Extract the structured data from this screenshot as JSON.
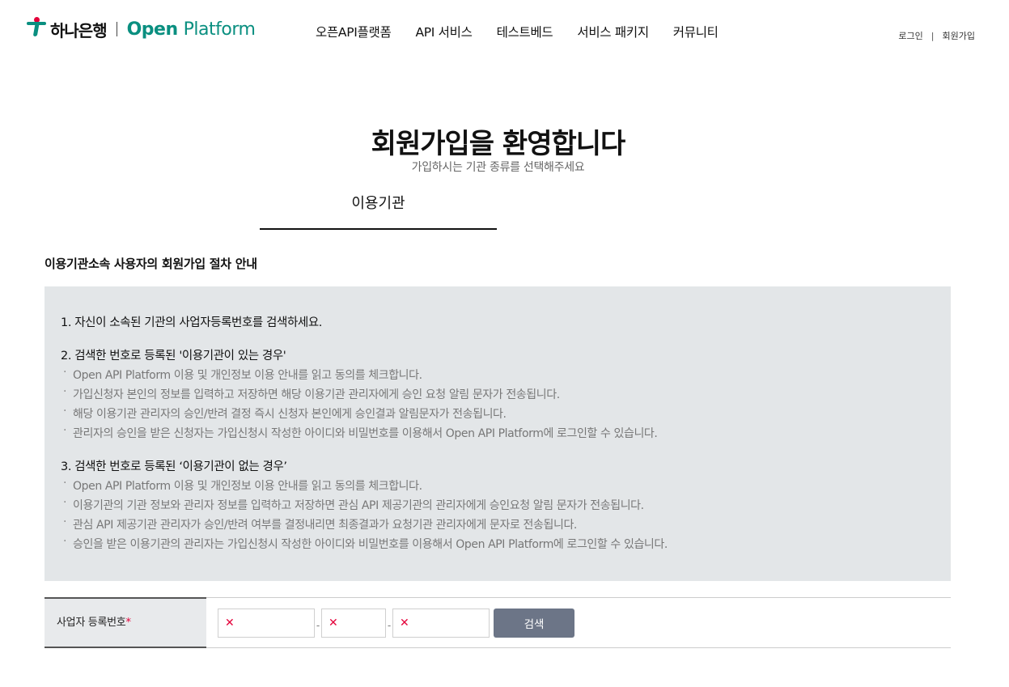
{
  "header": {
    "logo_kr": "하나은행",
    "logo_open": "Open",
    "logo_platform": "Platform",
    "nav": [
      "오픈API플랫폼",
      "API 서비스",
      "테스트베드",
      "서비스 패키지",
      "커뮤니티"
    ],
    "util": {
      "login": "로그인",
      "separator": "|",
      "signup": "회원가입"
    }
  },
  "title": {
    "main": "회원가입을 환영합니다",
    "sub": "가입하시는 기관 종류를 선택해주세요"
  },
  "tab": {
    "label": "이용기관"
  },
  "section": {
    "heading": "이용기관소속 사용자의 회원가입 절차 안내"
  },
  "steps": [
    {
      "title": "1. 자신이 소속된 기관의 사업자등록번호를 검색하세요.",
      "bullets": []
    },
    {
      "title": "2. 검색한 번호로 등록된 '이용기관이 있는 경우'",
      "bullets": [
        "Open API Platform 이용 및 개인정보 이용 안내를 읽고 동의를 체크합니다.",
        "가입신청자 본인의 정보를 입력하고 저장하면 해당 이용기관 관리자에게 승인 요청 알림 문자가 전송됩니다.",
        "해당 이용기관 관리자의 승인/반려 결정 즉시 신청자 본인에게 승인결과 알림문자가 전송됩니다.",
        "관리자의 승인을 받은 신청자는 가입신청시 작성한 아이디와 비밀번호를 이용해서 Open API Platform에 로그인할 수 있습니다."
      ]
    },
    {
      "title": "3. 검색한 번호로 등록된 ‘이용기관이 없는 경우’",
      "bullets": [
        "Open API Platform 이용 및 개인정보 이용 안내를 읽고 동의를 체크합니다.",
        "이용기관의 기관 정보와 관리자 정보를 입력하고 저장하면 관심 API 제공기관의 관리자에게 승인요청 알림 문자가 전송됩니다.",
        "관심 API 제공기관 관리자가 승인/반려 여부를 결정내리면 최종결과가 요청기관 관리자에게 문자로 전송됩니다.",
        "승인을 받은 이용기관의 관리자는 가입신청시 작성한 아이디와 비밀번호를 이용해서 Open API Platform에 로그인할 수 있습니다."
      ]
    }
  ],
  "form": {
    "label": "사업자 등록번호",
    "required_mark": "*",
    "field1": "",
    "field2": "",
    "field3": "",
    "dash": "-",
    "invalid_mark": "✕",
    "search_label": "검색"
  },
  "colors": {
    "brand": "#0a8f80",
    "accent_red": "#e4003a",
    "button": "#6c7587",
    "info_bg": "#e3e6e8"
  }
}
